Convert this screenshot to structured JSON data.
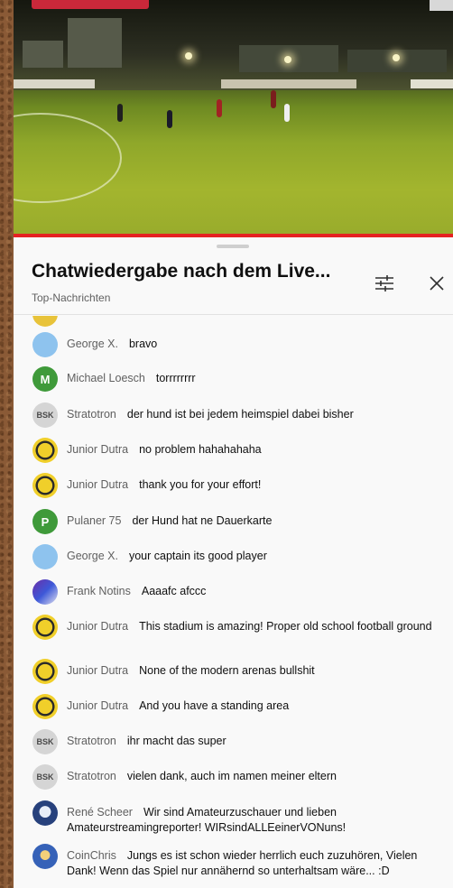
{
  "panel": {
    "title": "Chatwiedergabe nach dem Live...",
    "subtitle": "Top-Nachrichten",
    "icons": {
      "filter": "tune-icon",
      "close": "close-icon"
    }
  },
  "messages": [
    {
      "author": "George X.",
      "text": "bravo",
      "avatar": "blue",
      "initial": ""
    },
    {
      "author": "Michael Loesch",
      "text": "torrrrrrrr",
      "avatar": "green",
      "initial": "M"
    },
    {
      "author": "Stratotron",
      "text": "der hund ist bei jedem heimspiel dabei bisher",
      "avatar": "gray",
      "initial": "BSK"
    },
    {
      "author": "Junior Dutra",
      "text": "no problem hahahahaha",
      "avatar": "ball",
      "initial": ""
    },
    {
      "author": "Junior Dutra",
      "text": "thank you for your effort!",
      "avatar": "ball",
      "initial": ""
    },
    {
      "author": "Pulaner 75",
      "text": "der Hund hat ne Dauerkarte",
      "avatar": "green",
      "initial": "P"
    },
    {
      "author": "George X.",
      "text": "your captain its good player",
      "avatar": "blue",
      "initial": ""
    },
    {
      "author": "Frank Notins",
      "text": "Aaaafc afccc",
      "avatar": "flag",
      "initial": ""
    },
    {
      "author": "Junior Dutra",
      "text": "This stadium is amazing! Proper old school football ground",
      "avatar": "ball",
      "initial": ""
    },
    {
      "author": "Junior Dutra",
      "text": "None of the modern arenas bullshit",
      "avatar": "ball",
      "initial": ""
    },
    {
      "author": "Junior Dutra",
      "text": "And you have a standing area",
      "avatar": "ball",
      "initial": ""
    },
    {
      "author": "Stratotron",
      "text": "ihr macht das super",
      "avatar": "gray",
      "initial": "BSK"
    },
    {
      "author": "Stratotron",
      "text": "vielen dank, auch im namen meiner eltern",
      "avatar": "gray",
      "initial": "BSK"
    },
    {
      "author": "René Scheer",
      "text": "Wir sind Amateurzuschauer und lieben Amateurstreamingreporter! WIRsindALLEeinerVONuns!",
      "avatar": "rene",
      "initial": ""
    },
    {
      "author": "CoinChris",
      "text": "Jungs es ist schon wieder herrlich euch zuzuhören, Vielen Dank! Wenn das Spiel nur annähernd so unterhaltsam wäre... :D",
      "avatar": "coin",
      "initial": ""
    }
  ]
}
